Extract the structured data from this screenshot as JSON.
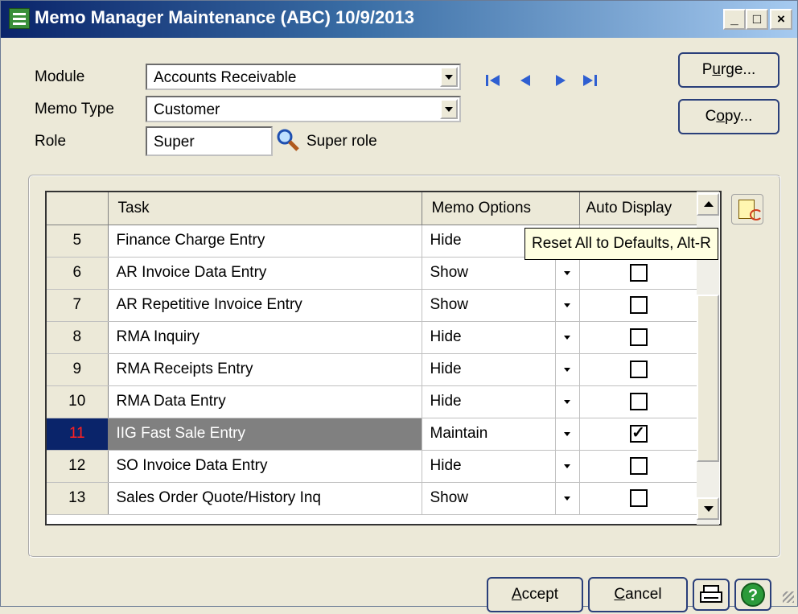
{
  "window": {
    "title": "Memo Manager Maintenance (ABC) 10/9/2013",
    "controls": [
      "_",
      "□",
      "×"
    ]
  },
  "form": {
    "module_label": "Module",
    "module_value": "Accounts Receivable",
    "memo_type_label": "Memo Type",
    "memo_type_value": "Customer",
    "role_label": "Role",
    "role_value": "Super",
    "role_description": "Super role"
  },
  "nav": {
    "first": "first-record-icon",
    "prev": "previous-record-icon",
    "next": "next-record-icon",
    "last": "last-record-icon"
  },
  "buttons": {
    "purge_u": "u",
    "purge_pre": "P",
    "purge_post": "rge...",
    "copy_u": "o",
    "copy_pre": "C",
    "copy_post": "py...",
    "accept_u": "A",
    "accept_post": "ccept",
    "cancel_u": "C",
    "cancel_post": "ancel"
  },
  "grid": {
    "headers": [
      "",
      "Task",
      "Memo Options",
      "Auto Display"
    ],
    "rows": [
      {
        "num": "5",
        "task": "Finance Charge Entry",
        "option": "Hide",
        "auto": false
      },
      {
        "num": "6",
        "task": "AR Invoice Data Entry",
        "option": "Show",
        "auto": false
      },
      {
        "num": "7",
        "task": "AR Repetitive Invoice Entry",
        "option": "Show",
        "auto": false
      },
      {
        "num": "8",
        "task": "RMA Inquiry",
        "option": "Hide",
        "auto": false
      },
      {
        "num": "9",
        "task": "RMA Receipts Entry",
        "option": "Hide",
        "auto": false
      },
      {
        "num": "10",
        "task": "RMA Data Entry",
        "option": "Hide",
        "auto": false
      },
      {
        "num": "11",
        "task": "IIG Fast Sale Entry",
        "option": "Maintain",
        "auto": true,
        "selected": true
      },
      {
        "num": "12",
        "task": "SO Invoice Data Entry",
        "option": "Hide",
        "auto": false
      },
      {
        "num": "13",
        "task": "Sales Order Quote/History Inq",
        "option": "Show",
        "auto": false
      }
    ]
  },
  "tooltip": "Reset All to Defaults, Alt-R",
  "colors": {
    "title_bar_start": "#0a246a",
    "title_bar_end": "#a6caf0",
    "face": "#ece9d8",
    "selected_row_num": "#0a246a",
    "selected_num_text": "#ff2020"
  }
}
